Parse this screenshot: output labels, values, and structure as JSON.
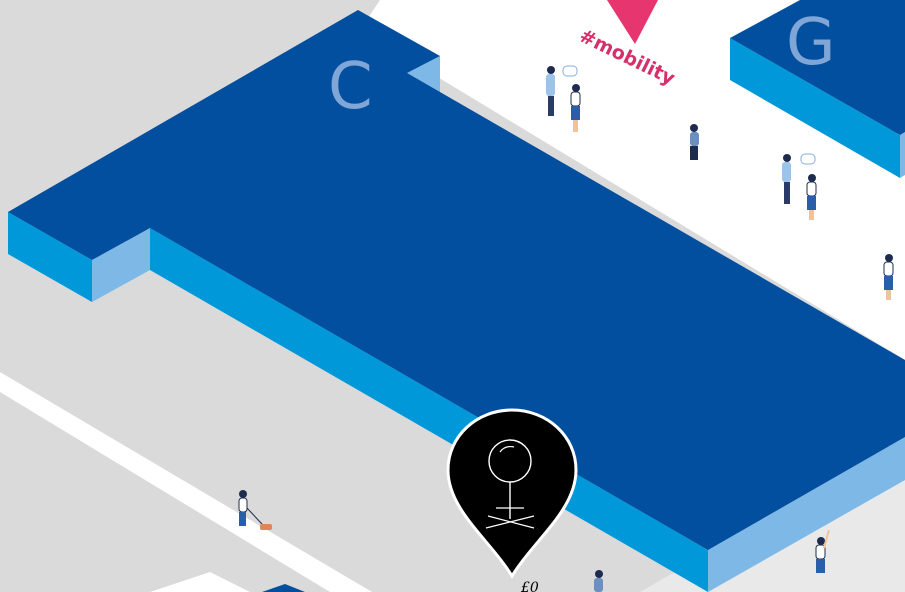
{
  "map": {
    "title": "",
    "buildings": [
      {
        "id": "C",
        "label": "C"
      },
      {
        "id": "G",
        "label": "G"
      }
    ],
    "hashtag": "#mobility",
    "pin": {
      "icon": "person-icon",
      "label": "£0"
    },
    "colors": {
      "ground": "#dadada",
      "walkway": "#ffffff",
      "building_top": "#014f9e",
      "building_side_dark": "#0098d8",
      "building_side_light": "#7db8e6",
      "hashtag": "#d6306b",
      "pin": "#000000"
    }
  }
}
